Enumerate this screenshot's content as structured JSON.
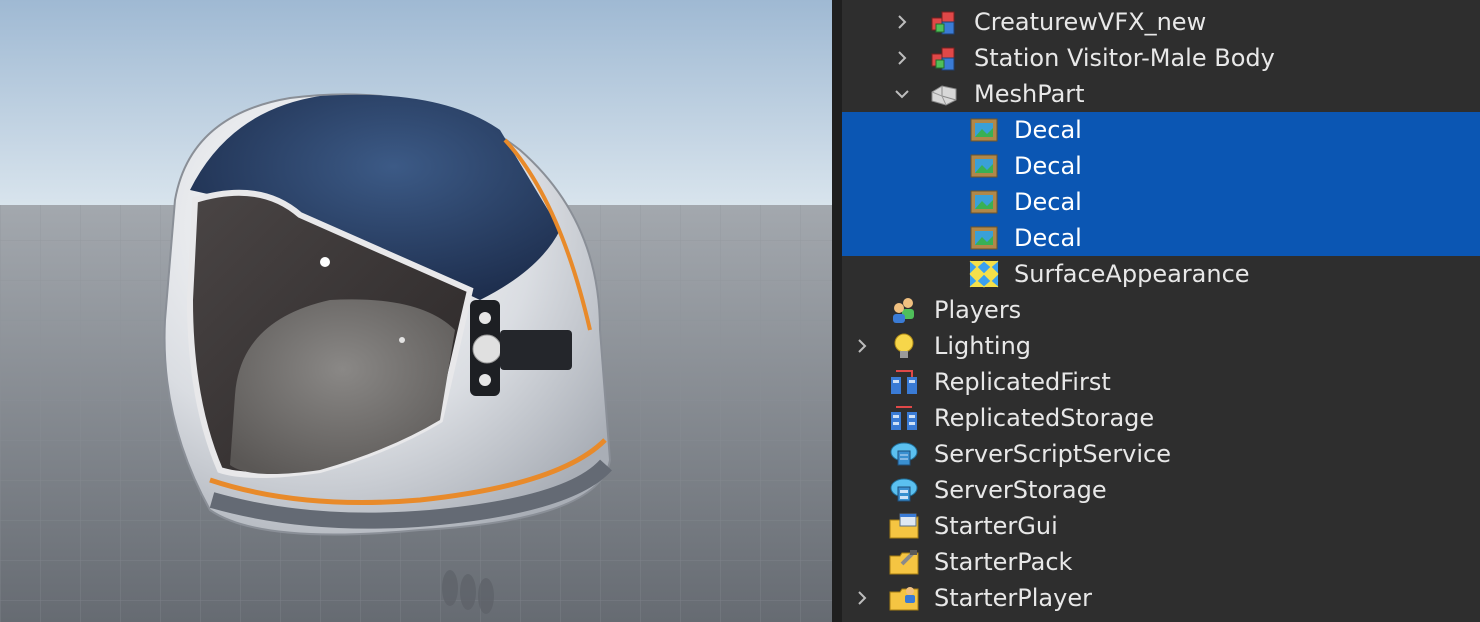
{
  "explorer": {
    "items": [
      {
        "label": "CreaturewVFX_new",
        "icon": "model-icon",
        "chevron": "collapsed",
        "selected": false
      },
      {
        "label": "Station Visitor-Male Body",
        "icon": "model-icon",
        "chevron": "collapsed",
        "selected": false
      },
      {
        "label": "MeshPart",
        "icon": "meshpart-icon",
        "chevron": "expanded",
        "selected": false
      },
      {
        "label": "Decal",
        "icon": "decal-icon",
        "chevron": "none",
        "selected": true
      },
      {
        "label": "Decal",
        "icon": "decal-icon",
        "chevron": "none",
        "selected": true
      },
      {
        "label": "Decal",
        "icon": "decal-icon",
        "chevron": "none",
        "selected": true
      },
      {
        "label": "Decal",
        "icon": "decal-icon",
        "chevron": "none",
        "selected": true
      },
      {
        "label": "SurfaceAppearance",
        "icon": "surface-appearance-icon",
        "chevron": "none",
        "selected": false
      },
      {
        "label": "Players",
        "icon": "players-icon",
        "chevron": "none",
        "selected": false
      },
      {
        "label": "Lighting",
        "icon": "lightbulb-icon",
        "chevron": "collapsed",
        "selected": false
      },
      {
        "label": "ReplicatedFirst",
        "icon": "replicated-first-icon",
        "chevron": "none",
        "selected": false
      },
      {
        "label": "ReplicatedStorage",
        "icon": "replicated-storage-icon",
        "chevron": "none",
        "selected": false
      },
      {
        "label": "ServerScriptService",
        "icon": "server-script-service-icon",
        "chevron": "none",
        "selected": false
      },
      {
        "label": "ServerStorage",
        "icon": "server-storage-icon",
        "chevron": "none",
        "selected": false
      },
      {
        "label": "StarterGui",
        "icon": "starter-gui-icon",
        "chevron": "none",
        "selected": false
      },
      {
        "label": "StarterPack",
        "icon": "starter-pack-icon",
        "chevron": "none",
        "selected": false
      },
      {
        "label": "StarterPlayer",
        "icon": "starter-player-icon",
        "chevron": "collapsed",
        "selected": false
      }
    ]
  },
  "colors": {
    "panel_bg": "#2e2e2e",
    "selection": "#0b56b3",
    "text": "#e8e8e8",
    "sky_top": "#a9c3dc",
    "baseplate": "#7d8187"
  }
}
